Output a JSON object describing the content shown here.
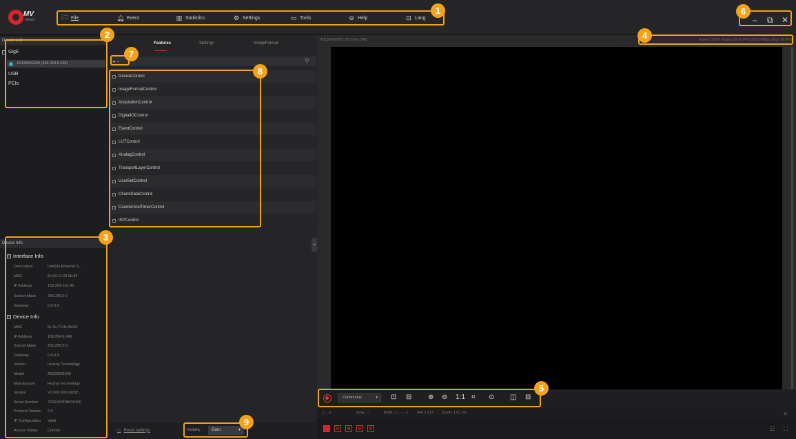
{
  "app": {
    "logo_text": "MV",
    "logo_sub": "viewer"
  },
  "menu": [
    {
      "icon": "file-icon",
      "label": "File"
    },
    {
      "icon": "bell-icon",
      "label": "Event"
    },
    {
      "icon": "chart-icon",
      "label": "Statistics"
    },
    {
      "icon": "gear-icon",
      "label": "Settings"
    },
    {
      "icon": "toolbox-icon",
      "label": "Tools"
    },
    {
      "icon": "help-icon",
      "label": "Help"
    },
    {
      "icon": "lang-icon",
      "label": "Lang"
    }
  ],
  "window": {
    "min": "–",
    "restore": "⧉",
    "close": "✕"
  },
  "device_list": {
    "title": "Device List",
    "groups": [
      "GigE",
      "USB",
      "PCIe"
    ],
    "selected_device": "A3136MG000 (169.254.6.248)"
  },
  "device_info": {
    "title": "Device Info",
    "interface_title": "Interface Info",
    "interface": [
      {
        "k": "Description",
        "v": "Intel(R) Ethernet S..."
      },
      {
        "k": "MAC",
        "v": "6c:b3:11:23:2b:84"
      },
      {
        "k": "IP Address",
        "v": "169.254.102.45"
      },
      {
        "k": "Subnet Mask",
        "v": "255.255.0.0"
      },
      {
        "k": "Gateway",
        "v": "0.0.0.0"
      }
    ],
    "device_title": "Device Info",
    "device": [
      {
        "k": "MAC",
        "v": "6c:1c:71:3c:3d:50"
      },
      {
        "k": "IP Address",
        "v": "169.254.6.248"
      },
      {
        "k": "Subnet Mask",
        "v": "255.255.0.0"
      },
      {
        "k": "Gateway",
        "v": "0.0.0.0"
      },
      {
        "k": "Vendor",
        "v": "Huaray Technology"
      },
      {
        "k": "Model",
        "v": "A3136MG000"
      },
      {
        "k": "Manufacture",
        "v": "Huaray Technology"
      },
      {
        "k": "Version",
        "v": "V1.000.00.0.R202..."
      },
      {
        "k": "Serial Number",
        "v": "7D0E947PAK00166"
      },
      {
        "k": "Protocol Version",
        "v": "2.0"
      },
      {
        "k": "IP Configuration",
        "v": "Valid"
      },
      {
        "k": "Access Status",
        "v": "Control"
      }
    ]
  },
  "tabs": [
    "Features",
    "Settings",
    "ImageFormat"
  ],
  "feature_search": {
    "add_label": "+ -"
  },
  "features": [
    "DeviceControl",
    "ImageFormatControl",
    "AcquisitionControl",
    "DigitalIOControl",
    "EventControl",
    "LUTControl",
    "AnalogControl",
    "TransportLayerControl",
    "UserSetControl",
    "ChunkDataControl",
    "CounterAndTimerControl",
    "ISPControl"
  ],
  "bottom_mid": {
    "reset": "Reset settings",
    "visibility_label": "Visibility",
    "visibility_value": "Guru"
  },
  "view": {
    "title": "A3136MG000 (169.254.6.248)",
    "stats": "Frame: 32876 images  99.26 FPS  260.22 Mbps  Disp: 30 FPS"
  },
  "toolbar": {
    "mode": "Continuous",
    "ratio": "1:1"
  },
  "status": {
    "coord": "(- , -)",
    "gray": "Gray : -",
    "rgb": "RGB : (- , - , -)",
    "size": "640 x 512",
    "zoom": "Zoom: 171.1%"
  },
  "annotations": [
    "1",
    "2",
    "3",
    "4",
    "5",
    "6",
    "7",
    "8",
    "9"
  ],
  "colors": {
    "accent": "#f4a21a",
    "brand_red": "#d8242c",
    "bg": "#1d1d1f"
  }
}
